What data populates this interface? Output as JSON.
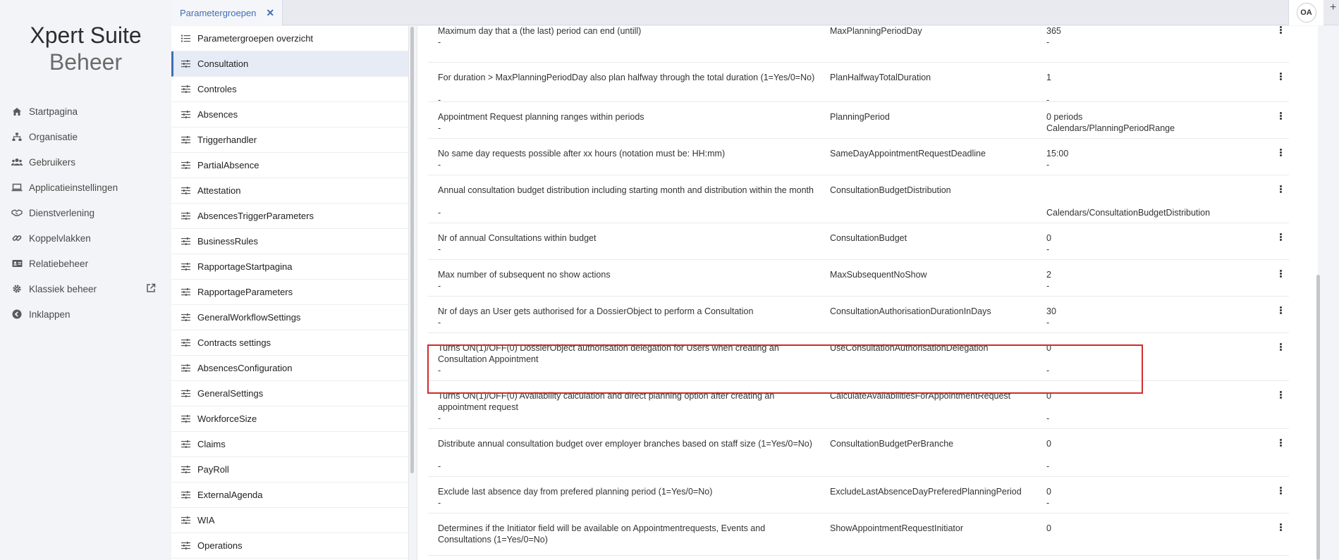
{
  "brand": {
    "line1": "Xpert Suite",
    "line2": "Beheer"
  },
  "nav": [
    {
      "label": "Startpagina",
      "icon": "home-icon"
    },
    {
      "label": "Organisatie",
      "icon": "sitemap-icon"
    },
    {
      "label": "Gebruikers",
      "icon": "users-icon"
    },
    {
      "label": "Applicatieinstellingen",
      "icon": "laptop-icon"
    },
    {
      "label": "Dienstverlening",
      "icon": "handshake-icon"
    },
    {
      "label": "Koppelvlakken",
      "icon": "link-icon"
    },
    {
      "label": "Relatiebeheer",
      "icon": "address-card-icon"
    },
    {
      "label": "Klassiek beheer",
      "icon": "gear-icon"
    },
    {
      "label": "Inklappen",
      "icon": "collapse-icon"
    }
  ],
  "tabs": [
    {
      "label": "Parametergroepen",
      "close": "✕"
    }
  ],
  "user": {
    "initials": "OA"
  },
  "groups": [
    "Parametergroepen overzicht",
    "Consultation",
    "Controles",
    "Absences",
    "Triggerhandler",
    "PartialAbsence",
    "Attestation",
    "AbsencesTriggerParameters",
    "BusinessRules",
    "RapportageStartpagina",
    "RapportageParameters",
    "GeneralWorkflowSettings",
    "Contracts settings",
    "AbsencesConfiguration",
    "GeneralSettings",
    "WorkforceSize",
    "Claims",
    "PayRoll",
    "ExternalAgenda",
    "WIA",
    "Operations"
  ],
  "active_group": "Consultation",
  "parameters": [
    {
      "desc": "Maximum day that a (the last) period can end (untill)",
      "desc2": "-",
      "name": "MaxPlanningPeriodDay",
      "value": "365",
      "value2": "-"
    },
    {
      "desc": "For duration > MaxPlanningPeriodDay also plan halfway through the total duration (1=Yes/0=No)",
      "desc2": "-",
      "name": "PlanHalfwayTotalDuration",
      "value": "1",
      "value2": "-"
    },
    {
      "desc": "Appointment Request planning ranges within periods",
      "desc2": "-",
      "name": "PlanningPeriod",
      "value": "0 periods",
      "value2": "Calendars/PlanningPeriodRange"
    },
    {
      "desc": "No same day requests possible after xx hours (notation must be: HH:mm)",
      "desc2": "-",
      "name": "SameDayAppointmentRequestDeadline",
      "value": "15:00",
      "value2": "-"
    },
    {
      "desc": "Annual consultation budget distribution including starting month and distribution within the month",
      "desc2": "-",
      "name": "ConsultationBudgetDistribution",
      "value": "",
      "value2": "Calendars/ConsultationBudgetDistribution"
    },
    {
      "desc": "Nr of annual Consultations within budget",
      "desc2": "-",
      "name": "ConsultationBudget",
      "value": "0",
      "value2": "-"
    },
    {
      "desc": "Max number of subsequent no show actions",
      "desc2": "-",
      "name": "MaxSubsequentNoShow",
      "value": "2",
      "value2": "-"
    },
    {
      "desc": "Nr of days an User gets authorised for a DossierObject to perform a Consultation",
      "desc2": "-",
      "name": "ConsultationAuthorisationDurationInDays",
      "value": "30",
      "value2": "-"
    },
    {
      "desc": "Turns ON(1)/OFF(0) DossierObject authorisation delegation for Users when creating an Consultation Appointment",
      "desc2": "-",
      "name": "UseConsultationAuthorisationDelegation",
      "value": "0",
      "value2": "-"
    },
    {
      "desc": "Turns ON(1)/OFF(0) Availability calculation and direct planning option after creating an appointment request",
      "desc2": "-",
      "name": "CalculateAvailabilitiesForAppointmentRequest",
      "value": "0",
      "value2": "-"
    },
    {
      "desc": "Distribute annual consultation budget over employer branches based on staff size (1=Yes/0=No)",
      "desc2": "-",
      "name": "ConsultationBudgetPerBranche",
      "value": "0",
      "value2": "-"
    },
    {
      "desc": "Exclude last absence day from prefered planning period (1=Yes/0=No)",
      "desc2": "-",
      "name": "ExcludeLastAbsenceDayPreferedPlanningPeriod",
      "value": "0",
      "value2": "-"
    },
    {
      "desc": "Determines if the Initiator field will be available on Appointmentrequests, Events and Consultations (1=Yes/0=No)",
      "desc2": "",
      "name": "ShowAppointmentRequestInitiator",
      "value": "0",
      "value2": ""
    }
  ],
  "colors": {
    "accent": "#3f6fb5",
    "highlight_border": "#d12b2b"
  }
}
